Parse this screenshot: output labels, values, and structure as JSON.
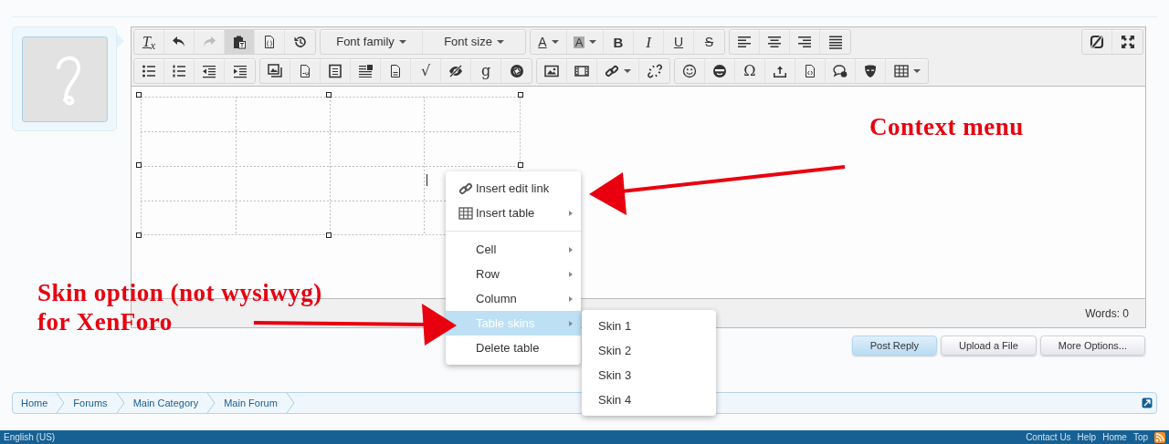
{
  "toolbar": {
    "rows": [
      [
        {
          "items": [
            {
              "kind": "clear",
              "label": "T$_{x}$",
              "active": false,
              "disabled": false,
              "dropdown": false
            },
            {
              "kind": "icon",
              "active": false,
              "disabled": false,
              "dropdown": false
            },
            {
              "kind": "icon",
              "active": false,
              "disabled": true,
              "dropdown": false
            },
            {
              "kind": "icon",
              "active": true,
              "disabled": false,
              "dropdown": false
            },
            {
              "kind": "icon",
              "active": false,
              "disabled": false,
              "dropdown": false
            },
            {
              "kind": "icon",
              "active": false,
              "disabled": false,
              "dropdown": false
            }
          ]
        },
        {
          "items": [
            {
              "kind": "select",
              "label": "Font family",
              "active": false,
              "disabled": false,
              "dropdown": true
            },
            {
              "kind": "select",
              "label": "Font size",
              "active": false,
              "disabled": false,
              "dropdown": true
            }
          ]
        },
        {
          "items": [
            {
              "kind": "text-color",
              "label": "A",
              "active": false,
              "disabled": false,
              "dropdown": true
            },
            {
              "kind": "highlight",
              "label": "A",
              "active": false,
              "disabled": false,
              "dropdown": true
            },
            {
              "kind": "bold",
              "label": "B",
              "active": false,
              "disabled": false,
              "dropdown": false
            },
            {
              "kind": "italic",
              "label": "I",
              "active": false,
              "disabled": false,
              "dropdown": false
            },
            {
              "kind": "underline",
              "label": "U",
              "active": false,
              "disabled": false,
              "dropdown": false
            },
            {
              "kind": "strike",
              "label": "S",
              "active": false,
              "disabled": false,
              "dropdown": false
            }
          ]
        },
        {
          "items": [
            {
              "kind": "icon",
              "active": false,
              "disabled": false,
              "dropdown": false
            },
            {
              "kind": "icon",
              "active": false,
              "disabled": false,
              "dropdown": false
            },
            {
              "kind": "icon",
              "active": false,
              "disabled": false,
              "dropdown": false
            },
            {
              "kind": "icon",
              "active": false,
              "disabled": false,
              "dropdown": false
            }
          ]
        }
      ],
      [
        {
          "items": [
            {
              "kind": "icon",
              "active": false,
              "disabled": false,
              "dropdown": false
            },
            {
              "kind": "icon",
              "active": false,
              "disabled": false,
              "dropdown": false
            },
            {
              "kind": "icon",
              "active": false,
              "disabled": false,
              "dropdown": false
            },
            {
              "kind": "icon",
              "active": false,
              "disabled": false,
              "dropdown": false
            }
          ]
        },
        {
          "items": [
            {
              "kind": "icon",
              "active": false,
              "disabled": false,
              "dropdown": false
            },
            {
              "kind": "icon",
              "active": false,
              "disabled": false,
              "dropdown": false
            },
            {
              "kind": "icon",
              "active": false,
              "disabled": false,
              "dropdown": false
            },
            {
              "kind": "icon",
              "active": false,
              "disabled": false,
              "dropdown": false
            },
            {
              "kind": "icon",
              "active": false,
              "disabled": false,
              "dropdown": false
            },
            {
              "kind": "glyph",
              "label": "√",
              "active": false,
              "disabled": false,
              "dropdown": false
            },
            {
              "kind": "icon",
              "active": false,
              "disabled": false,
              "dropdown": false
            },
            {
              "kind": "glyph",
              "label": "g",
              "active": false,
              "disabled": false,
              "dropdown": false
            },
            {
              "kind": "icon",
              "active": false,
              "disabled": false,
              "dropdown": false
            }
          ]
        },
        {
          "items": [
            {
              "kind": "icon",
              "active": false,
              "disabled": false,
              "dropdown": false
            },
            {
              "kind": "icon",
              "active": false,
              "disabled": false,
              "dropdown": false
            },
            {
              "kind": "icon",
              "active": false,
              "disabled": false,
              "dropdown": true
            },
            {
              "kind": "icon",
              "active": false,
              "disabled": false,
              "dropdown": false
            }
          ]
        },
        {
          "items": [
            {
              "kind": "icon",
              "active": false,
              "disabled": false,
              "dropdown": false
            },
            {
              "kind": "icon",
              "active": false,
              "disabled": false,
              "dropdown": false
            },
            {
              "kind": "glyph",
              "label": "Ω",
              "active": false,
              "disabled": false,
              "dropdown": false
            },
            {
              "kind": "icon",
              "active": false,
              "disabled": false,
              "dropdown": false
            },
            {
              "kind": "icon",
              "active": false,
              "disabled": false,
              "dropdown": false
            },
            {
              "kind": "icon",
              "active": false,
              "disabled": false,
              "dropdown": false
            },
            {
              "kind": "icon",
              "active": false,
              "disabled": false,
              "dropdown": false
            },
            {
              "kind": "icon",
              "active": false,
              "disabled": false,
              "dropdown": true
            }
          ]
        }
      ]
    ],
    "side": {
      "items": [
        {
          "kind": "icon",
          "active": false,
          "disabled": false,
          "dropdown": false
        },
        {
          "kind": "icon",
          "active": false,
          "disabled": false,
          "dropdown": false
        }
      ]
    }
  },
  "word_count": "Words: 0",
  "context_menu": {
    "sections": [
      [
        {
          "kind": "link",
          "label": "Insert edit link",
          "submenu": false,
          "selected": false
        },
        {
          "kind": "table",
          "label": "Insert table",
          "submenu": true,
          "selected": false
        }
      ],
      [
        {
          "kind": "plain",
          "label": "Cell",
          "submenu": true,
          "selected": false
        },
        {
          "kind": "plain",
          "label": "Row",
          "submenu": true,
          "selected": false
        },
        {
          "kind": "plain",
          "label": "Column",
          "submenu": true,
          "selected": false
        },
        {
          "kind": "plain",
          "label": "Table skins",
          "submenu": true,
          "selected": true
        },
        {
          "kind": "plain",
          "label": "Delete table",
          "submenu": false,
          "selected": false
        }
      ]
    ]
  },
  "submenu": [
    {
      "label": "Skin 1",
      "selected": false
    },
    {
      "label": "Skin 2",
      "selected": false
    },
    {
      "label": "Skin 3",
      "selected": false
    },
    {
      "label": "Skin 4",
      "selected": false
    }
  ],
  "buttons": [
    {
      "label": "Post Reply",
      "kind": "primary"
    },
    {
      "label": "Upload a File",
      "kind": "default"
    },
    {
      "label": "More Options...",
      "kind": "default"
    }
  ],
  "breadcrumb": [
    {
      "label": "Home"
    },
    {
      "label": "Forums"
    },
    {
      "label": "Main Category"
    },
    {
      "label": "Main Forum"
    }
  ],
  "footer": {
    "language": "English (US)",
    "links": [
      {
        "label": "Contact Us"
      },
      {
        "label": "Help"
      },
      {
        "label": "Home"
      },
      {
        "label": "Top"
      }
    ]
  },
  "annotations": [
    {
      "text": "Context menu"
    },
    {
      "text": "Skin option (not wysiwyg)"
    },
    {
      "text": "for XenForo"
    }
  ]
}
